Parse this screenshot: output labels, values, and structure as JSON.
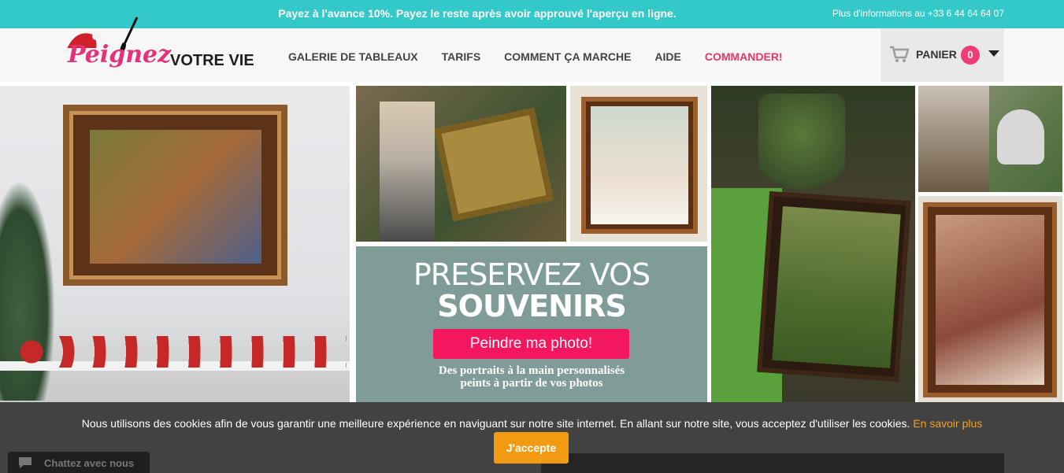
{
  "topbar": {
    "promo": "Payez à l'avance 10%. Payez le reste après avoir approuvé l'aperçu en ligne.",
    "info": "Plus d'informations au +33 6 44 64 64 07"
  },
  "logo": {
    "script": "Peignez",
    "plain": "VOTRE VIE"
  },
  "nav": {
    "items": [
      "GALERIE DE TABLEAUX",
      "TARIFS",
      "COMMENT ÇA MARCHE",
      "AIDE"
    ],
    "cta": "COMMANDER!"
  },
  "cart": {
    "label": "PANIER",
    "count": "0"
  },
  "promo": {
    "headline_1": "PRESERVEZ VOS",
    "headline_2": "SOUVENIRS",
    "button": "Peindre ma photo!",
    "sub_line_1": "Des portraits à la main personnalisés",
    "sub_line_2": "peints à partir de vos photos"
  },
  "cookie": {
    "message": "Nous utilisons des cookies afin de vous garantir une meilleure expérience en naviguant sur notre site internet. En allant sur notre site, vous acceptez d'utiliser les cookies.",
    "more": "En savoir plus",
    "accept": "J'accepte"
  },
  "chat": {
    "label": "Chattez avec nous"
  },
  "colors": {
    "accent_teal": "#33c9c9",
    "brand_pink": "#f2175f",
    "cookie_orange": "#f39a13"
  }
}
